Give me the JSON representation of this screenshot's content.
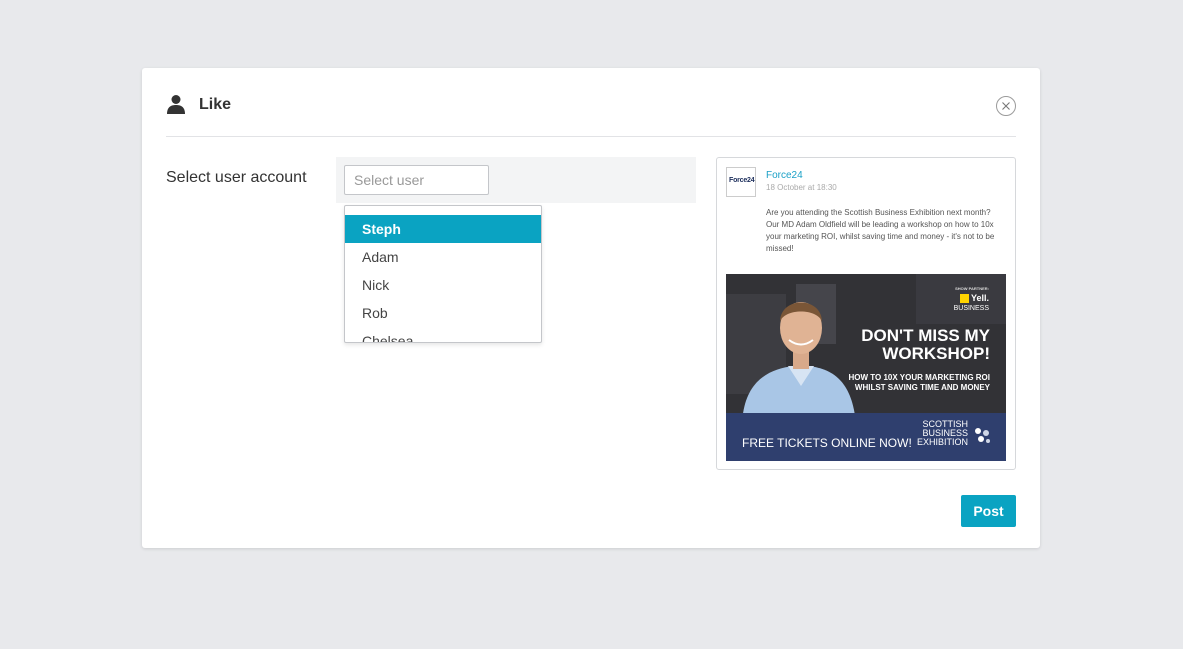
{
  "modal": {
    "title": "Like",
    "title_icon": "user-icon",
    "close_icon": "close-icon"
  },
  "form": {
    "label": "Select user account",
    "select_placeholder": "Select user",
    "options": [
      "Steph",
      "Adam",
      "Nick",
      "Rob",
      "Chelsea"
    ],
    "highlighted_index": 0
  },
  "post": {
    "avatar_text": "Force24",
    "page_name": "Force24",
    "date": "18 October at 18:30",
    "text": "Are you attending the Scottish Business Exhibition next month? Our MD Adam Oldfield will be leading a workshop on how to 10x your marketing ROI, whilst saving time and money - it's not to be missed!",
    "image": {
      "partner_label": "SHOW PARTNER:",
      "logo_name": "Yell.",
      "logo_sub": "BUSINESS",
      "headline": "DON'T MISS MY WORKSHOP!",
      "subline": "HOW TO 10X YOUR MARKETING ROI WHILST SAVING TIME AND MONEY",
      "cta": "FREE TICKETS ONLINE NOW!",
      "exhibition_line1": "SCOTTISH",
      "exhibition_line2": "BUSINESS",
      "exhibition_line3": "EXHIBITION"
    }
  },
  "actions": {
    "post_label": "Post"
  },
  "colors": {
    "accent": "#0aa3c2",
    "link": "#1aa0c6",
    "ad_footer": "#2f3f6e",
    "yell_yellow": "#ffd400"
  }
}
